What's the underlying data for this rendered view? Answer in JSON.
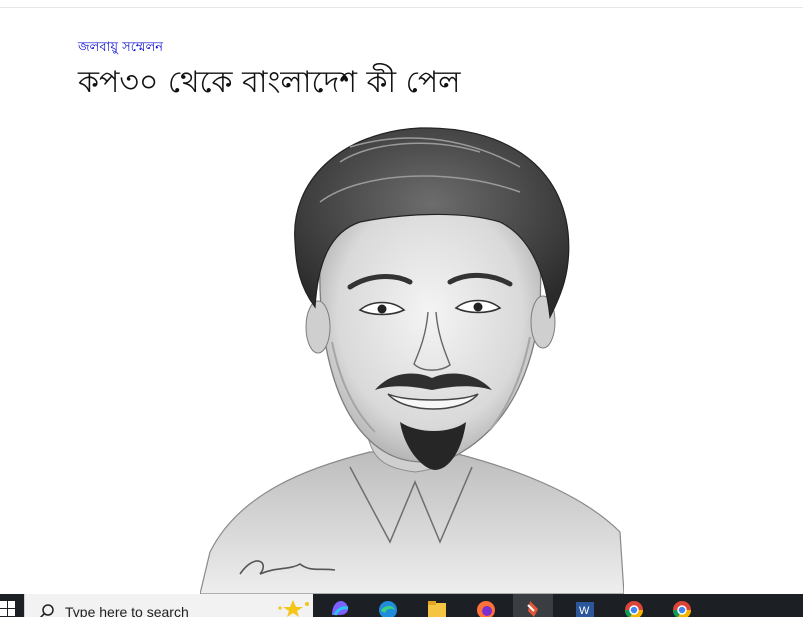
{
  "article": {
    "category": "জলবায়ু সম্মেলন",
    "headline": "কপ৩০ থেকে বাংলাদেশ কী পেল"
  },
  "taskbar": {
    "search_placeholder": "Type here to search",
    "pinned_apps": [
      {
        "name": "copilot-icon"
      },
      {
        "name": "edge-icon"
      },
      {
        "name": "file-explorer-icon"
      },
      {
        "name": "firefox-icon"
      },
      {
        "name": "app-icon",
        "active": true
      },
      {
        "name": "word-icon"
      },
      {
        "name": "chrome-icon"
      },
      {
        "name": "chrome-icon"
      }
    ]
  },
  "colors": {
    "category_link": "#0a0ad6",
    "headline_text": "#111111",
    "taskbar_bg": "#1c1f24",
    "search_bg": "#f2f2f2"
  }
}
